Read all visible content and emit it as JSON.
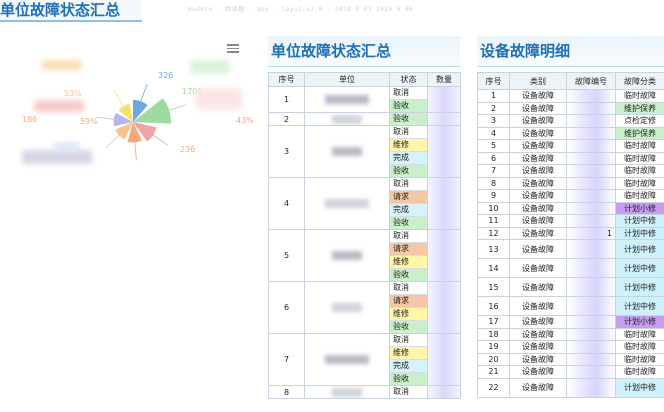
{
  "page": {
    "title": "单位故障状态汇总",
    "faded_header": "modern · 阅读器 · app · layui-v2.0 · 2018-0-03 2020-0-06"
  },
  "colors": {
    "cancel": "#ffffff",
    "accept": "#c9f0c9",
    "repair": "#fff6a8",
    "done": "#d6f3fb",
    "request": "#f6c7a4",
    "small_plan": "#c79cf2",
    "mid_plan": "#cff1fb",
    "temp": "#ffffff",
    "maint": "#c9f0c9",
    "spot": "#ffffff"
  },
  "icons": {
    "menu": "hamburger-menu-icon"
  },
  "chart_data": {
    "type": "pie",
    "subtype": "rose",
    "labels": [
      "326",
      "1701",
      "43%",
      "236",
      "186",
      "59%",
      "53%"
    ],
    "slices": [
      {
        "value": 326,
        "color": "#6ea8dd"
      },
      {
        "value": 1701,
        "color": "#9fd9a3"
      },
      {
        "value": 430,
        "color": "#f0a3a3"
      },
      {
        "value": 236,
        "color": "#f4a97b"
      },
      {
        "value": 186,
        "color": "#f7c48a"
      },
      {
        "value": 190,
        "color": "#b8b6f2"
      },
      {
        "value": 153,
        "color": "#f4e46a"
      }
    ]
  },
  "left_table": {
    "title": "单位故障状态汇总",
    "headers": [
      "序号",
      "单位",
      "状态",
      "数量"
    ],
    "rows": [
      {
        "no": "1",
        "statuses": [
          {
            "text": "取消",
            "kind": "cancel"
          },
          {
            "text": "验收",
            "kind": "accept"
          }
        ]
      },
      {
        "no": "2",
        "statuses": [
          {
            "text": "验收",
            "kind": "accept"
          }
        ]
      },
      {
        "no": "3",
        "statuses": [
          {
            "text": "取消",
            "kind": "cancel"
          },
          {
            "text": "维修",
            "kind": "repair"
          },
          {
            "text": "完成",
            "kind": "done"
          },
          {
            "text": "验收",
            "kind": "accept"
          }
        ]
      },
      {
        "no": "4",
        "statuses": [
          {
            "text": "取消",
            "kind": "cancel"
          },
          {
            "text": "请求",
            "kind": "request"
          },
          {
            "text": "完成",
            "kind": "done"
          },
          {
            "text": "验收",
            "kind": "accept"
          }
        ]
      },
      {
        "no": "5",
        "statuses": [
          {
            "text": "取消",
            "kind": "cancel"
          },
          {
            "text": "请求",
            "kind": "request"
          },
          {
            "text": "维修",
            "kind": "repair"
          },
          {
            "text": "验收",
            "kind": "accept"
          }
        ]
      },
      {
        "no": "6",
        "statuses": [
          {
            "text": "取消",
            "kind": "cancel"
          },
          {
            "text": "请求",
            "kind": "request"
          },
          {
            "text": "维修",
            "kind": "repair"
          },
          {
            "text": "验收",
            "kind": "accept"
          }
        ]
      },
      {
        "no": "7",
        "statuses": [
          {
            "text": "取消",
            "kind": "cancel"
          },
          {
            "text": "维修",
            "kind": "repair"
          },
          {
            "text": "完成",
            "kind": "done"
          },
          {
            "text": "验收",
            "kind": "accept"
          }
        ]
      },
      {
        "no": "8",
        "statuses": [
          {
            "text": "取消",
            "kind": "cancel"
          }
        ]
      }
    ]
  },
  "right_table": {
    "title": "设备故障明细",
    "headers": [
      "序号",
      "类别",
      "故障编号",
      "故障分类"
    ],
    "rows": [
      {
        "no": "1",
        "cat": "设备故障",
        "cls": "临时故障",
        "kind": "temp",
        "tall": false,
        "mark": ""
      },
      {
        "no": "2",
        "cat": "设备故障",
        "cls": "维护保养",
        "kind": "maint",
        "tall": false,
        "mark": ""
      },
      {
        "no": "3",
        "cat": "设备故障",
        "cls": "点检定修",
        "kind": "spot",
        "tall": false,
        "mark": ""
      },
      {
        "no": "4",
        "cat": "设备故障",
        "cls": "维护保养",
        "kind": "maint",
        "tall": false,
        "mark": ""
      },
      {
        "no": "5",
        "cat": "设备故障",
        "cls": "临时故障",
        "kind": "temp",
        "tall": false,
        "mark": ""
      },
      {
        "no": "6",
        "cat": "设备故障",
        "cls": "临时故障",
        "kind": "temp",
        "tall": false,
        "mark": ""
      },
      {
        "no": "7",
        "cat": "设备故障",
        "cls": "临时故障",
        "kind": "temp",
        "tall": false,
        "mark": ""
      },
      {
        "no": "8",
        "cat": "设备故障",
        "cls": "临时故障",
        "kind": "temp",
        "tall": false,
        "mark": ""
      },
      {
        "no": "9",
        "cat": "设备故障",
        "cls": "临时故障",
        "kind": "temp",
        "tall": false,
        "mark": ""
      },
      {
        "no": "10",
        "cat": "设备故障",
        "cls": "计划小修",
        "kind": "small_plan",
        "tall": false,
        "mark": ""
      },
      {
        "no": "11",
        "cat": "设备故障",
        "cls": "计划中修",
        "kind": "mid_plan",
        "tall": false,
        "mark": ""
      },
      {
        "no": "12",
        "cat": "设备故障",
        "cls": "计划中修",
        "kind": "mid_plan",
        "tall": false,
        "mark": "1"
      },
      {
        "no": "13",
        "cat": "设备故障",
        "cls": "计划中修",
        "kind": "mid_plan",
        "tall": true,
        "mark": ""
      },
      {
        "no": "14",
        "cat": "设备故障",
        "cls": "计划中修",
        "kind": "mid_plan",
        "tall": true,
        "mark": ""
      },
      {
        "no": "15",
        "cat": "设备故障",
        "cls": "计划中修",
        "kind": "mid_plan",
        "tall": true,
        "mark": ""
      },
      {
        "no": "16",
        "cat": "设备故障",
        "cls": "计划中修",
        "kind": "mid_plan",
        "tall": true,
        "mark": ""
      },
      {
        "no": "17",
        "cat": "设备故障",
        "cls": "计划小修",
        "kind": "small_plan",
        "tall": false,
        "mark": ""
      },
      {
        "no": "18",
        "cat": "设备故障",
        "cls": "临时故障",
        "kind": "temp",
        "tall": false,
        "mark": ""
      },
      {
        "no": "19",
        "cat": "设备故障",
        "cls": "临时故障",
        "kind": "temp",
        "tall": false,
        "mark": ""
      },
      {
        "no": "20",
        "cat": "设备故障",
        "cls": "临时故障",
        "kind": "temp",
        "tall": false,
        "mark": ""
      },
      {
        "no": "21",
        "cat": "设备故障",
        "cls": "临时故障",
        "kind": "temp",
        "tall": false,
        "mark": ""
      },
      {
        "no": "22",
        "cat": "设备故障",
        "cls": "计划中修",
        "kind": "mid_plan",
        "tall": true,
        "mark": ""
      }
    ]
  }
}
